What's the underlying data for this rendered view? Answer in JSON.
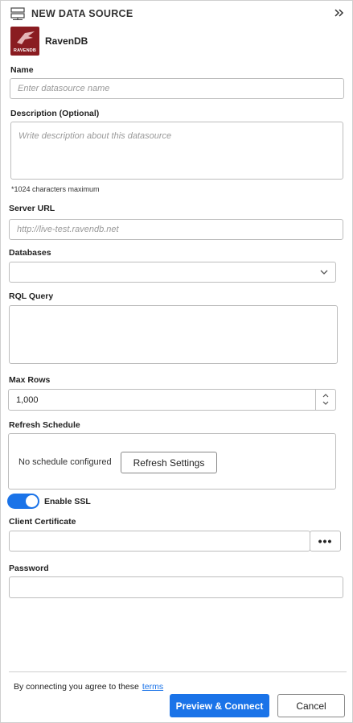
{
  "header": {
    "title": "NEW DATA SOURCE",
    "icon": "server-icon",
    "collapse_icon": "double-chevron-right-icon"
  },
  "provider": {
    "name": "RavenDB",
    "logo_text": "RAVENDB",
    "logo_color": "#8a1c21"
  },
  "name_field": {
    "label": "Name",
    "placeholder": "Enter datasource name"
  },
  "description_field": {
    "label": "Description (Optional)",
    "placeholder": "Write description about this datasource",
    "note": "*1024 characters maximum"
  },
  "server_url_field": {
    "label": "Server URL",
    "placeholder": "http://live-test.ravendb.net"
  },
  "databases_field": {
    "label": "Databases",
    "value": ""
  },
  "rql_field": {
    "label": "RQL Query",
    "value": ""
  },
  "max_rows_field": {
    "label": "Max Rows",
    "value": "1,000"
  },
  "refresh": {
    "label": "Refresh Schedule",
    "status": "No schedule configured",
    "button": "Refresh Settings"
  },
  "ssl": {
    "label": "Enable SSL",
    "enabled": true
  },
  "certificate": {
    "label": "Client Certificate",
    "value": "",
    "browse_label": "•••"
  },
  "password": {
    "label": "Password",
    "value": ""
  },
  "footer": {
    "agree_text": "By connecting you agree to these",
    "terms_link": "terms",
    "primary_button": "Preview & Connect",
    "cancel_button": "Cancel"
  },
  "colors": {
    "accent": "#1a73e8",
    "border": "#bdbdbd"
  }
}
